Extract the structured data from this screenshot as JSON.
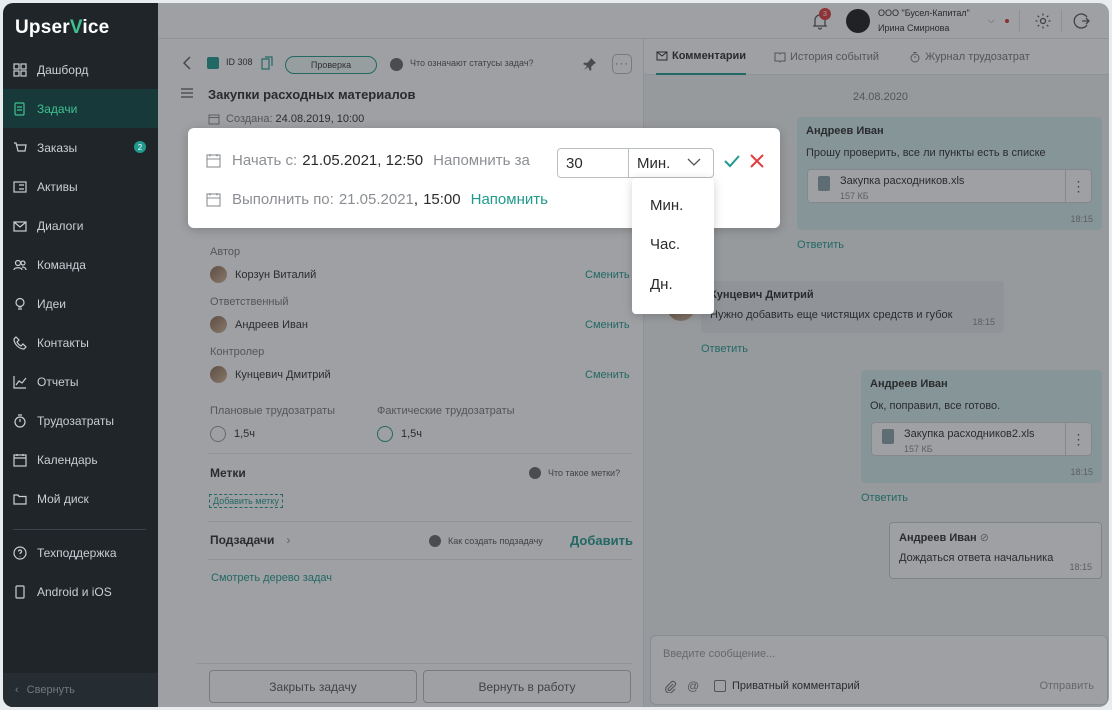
{
  "app": {
    "logo_a": "Upser",
    "logo_b": "V",
    "logo_c": "ice"
  },
  "sidebar": {
    "items": [
      {
        "label": "Дашборд",
        "icon": "grid-icon"
      },
      {
        "label": "Задачи",
        "icon": "task-icon",
        "active": true
      },
      {
        "label": "Заказы",
        "icon": "cart-icon",
        "badge": "2"
      },
      {
        "label": "Активы",
        "icon": "assets-icon"
      },
      {
        "label": "Диалоги",
        "icon": "mail-icon"
      },
      {
        "label": "Команда",
        "icon": "team-icon"
      },
      {
        "label": "Идеи",
        "icon": "bulb-icon"
      },
      {
        "label": "Контакты",
        "icon": "phone-icon"
      },
      {
        "label": "Отчеты",
        "icon": "chart-icon"
      },
      {
        "label": "Трудозатраты",
        "icon": "timer-icon"
      },
      {
        "label": "Календарь",
        "icon": "calendar-icon"
      },
      {
        "label": "Мой диск",
        "icon": "folder-icon"
      }
    ],
    "bottom": [
      {
        "label": "Техподдержка",
        "icon": "help-icon"
      },
      {
        "label": "Android и iOS",
        "icon": "mobile-icon"
      }
    ],
    "collapse": "Свернуть"
  },
  "topbar": {
    "notif_count": "3",
    "org_name": "ООО \"Бусел-Капитал\"",
    "user_name": "Ирина Смирнова"
  },
  "task": {
    "id": "ID 308",
    "status": "Проверка",
    "status_help": "Что означают статусы задач?",
    "title": "Закупки расходных материалов",
    "created_label": "Создана:",
    "created_value": "24.08.2019, 10:00",
    "author_label": "Автор",
    "author_name": "Корзун Виталий",
    "responsible_label": "Ответственный",
    "responsible_name": "Андреев Иван",
    "controller_label": "Контролер",
    "controller_name": "Кунцевич Дмитрий",
    "change_label": "Сменить",
    "planned_label": "Плановые трудозатраты",
    "planned_value": "1,5ч",
    "actual_label": "Фактические трудозатраты",
    "actual_value": "1,5ч",
    "tags_title": "Метки",
    "tags_help": "Что такое метки?",
    "add_tag": "Добавить метку",
    "subtasks_title": "Подзадачи",
    "subtasks_help": "Как создать подзадачу",
    "subtasks_add": "Добавить",
    "tree_link": "Смотреть дерево задач",
    "close_btn": "Закрыть задачу",
    "return_btn": "Вернуть в работу"
  },
  "comments": {
    "tabs": [
      "Комментарии",
      "История событий",
      "Журнал трудозатрат"
    ],
    "date": "24.08.2020",
    "reply": "Ответить",
    "messages": [
      {
        "author": "Андреев Иван",
        "text": "Прошу проверить, все ли пункты есть в списке",
        "file": "Закупка расходников.xls",
        "size": "157 КБ",
        "time": "18:15"
      },
      {
        "author": "Кунцевич Дмитрий",
        "text": "Нужно добавить еще чистящих средств и губок",
        "time": "18:15"
      },
      {
        "author": "Андреев Иван",
        "text": "Ок, поправил, все готово.",
        "file": "Закупка расходников2.xls",
        "size": "157 КБ",
        "time": "18:15"
      },
      {
        "author": "Андреев Иван",
        "text": "Дождаться ответа начальника",
        "time": "18:15"
      }
    ],
    "input_placeholder": "Введите сообщение...",
    "private_label": "Приватный комментарий",
    "send": "Отправить"
  },
  "modal": {
    "start_label": "Начать с:",
    "start_value": "21.05.2021, 12:50",
    "remind_label": "Напомнить за",
    "remind_value": "30",
    "unit_value": "Мин.",
    "due_label": "Выполнить по:",
    "due_date": "21.05.2021",
    "due_sep": ",",
    "due_time": "15:00",
    "remind_link": "Напомнить",
    "unit_options": [
      "Мин.",
      "Час.",
      "Дн."
    ]
  },
  "colors": {
    "accent": "#1f9a8c",
    "sidebar_bg": "#1f2529",
    "danger": "#e23b3b"
  }
}
